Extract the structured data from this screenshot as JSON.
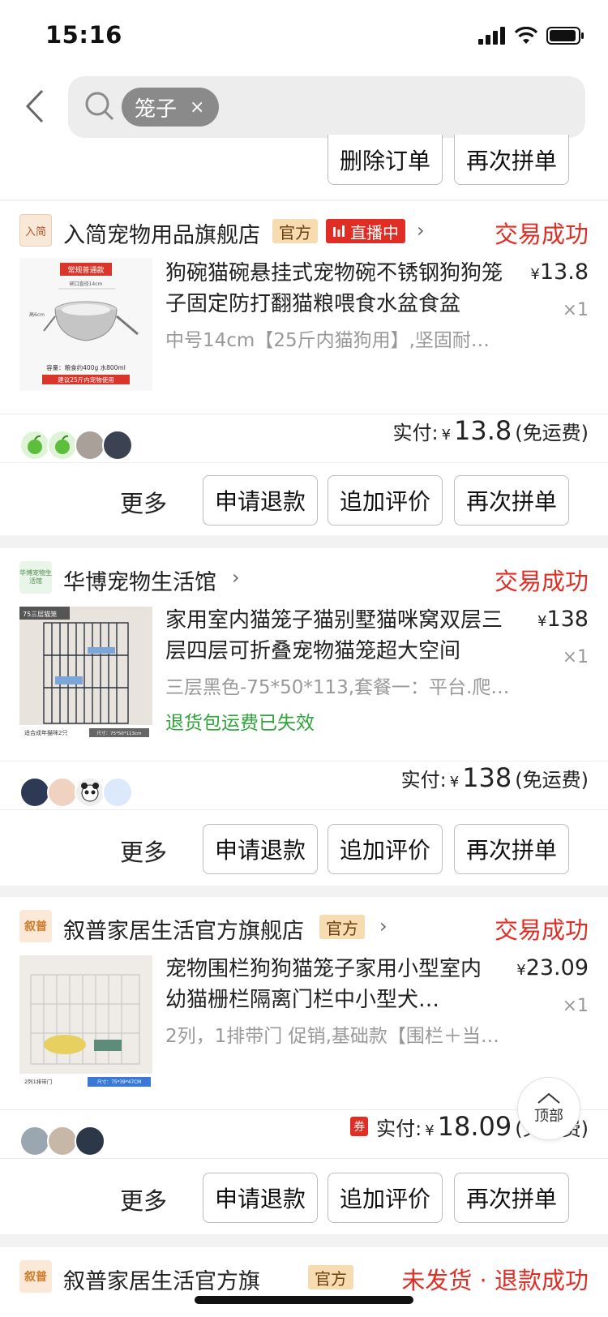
{
  "status_bar": {
    "time": "15:16"
  },
  "search": {
    "keyword": "笼子",
    "clear": "×"
  },
  "top_partial_card": {
    "buttons": [
      "删除订单",
      "再次拼单"
    ]
  },
  "orders": [
    {
      "shop": "入简宠物用品旗舰店",
      "logo_text": "入简",
      "official_badge": "官方",
      "live_badge": "直播中",
      "status": "交易成功",
      "title": "狗碗猫碗悬挂式宠物碗不锈钢狗狗笼子固定防打翻猫粮喂食水盆食盆",
      "spec": "中号14cm【25斤内猫狗用】,坚固耐…",
      "price_currency": "¥",
      "price": "13.8",
      "qty": "×1",
      "paid_label": "实付:",
      "paid_currency": "¥",
      "paid_amount": "13.8",
      "shipping": "(免运费)",
      "more": "更多",
      "actions": [
        "申请退款",
        "追加评价",
        "再次拼单"
      ],
      "thumb_texts": [
        "常规普通款",
        "碗口直径14cm",
        "高6cm",
        "容量：粮食约400g  水800ml",
        "建议25斤内宠物使用"
      ]
    },
    {
      "shop": "华博宠物生活馆",
      "logo_text": "华博宠物生活馆",
      "status": "交易成功",
      "title": "家用室内猫笼子猫别墅猫咪窝双层三层四层可折叠宠物猫笼超大空间",
      "spec": "三层黑色-75*50*113,套餐一：平台.爬…",
      "refund_note": "退货包运费已失效",
      "price_currency": "¥",
      "price": "138",
      "qty": "×1",
      "paid_label": "实付:",
      "paid_currency": "¥",
      "paid_amount": "138",
      "shipping": "(免运费)",
      "more": "更多",
      "actions": [
        "申请退款",
        "追加评价",
        "再次拼单"
      ],
      "thumb_texts": [
        "75三层猫笼",
        "适合成年猫咪2只",
        "尺寸：75*50*113cm"
      ]
    },
    {
      "shop": "叙普家居生活官方旗舰店",
      "logo_text": "叙普",
      "official_badge": "官方",
      "status": "交易成功",
      "title": "宠物围栏狗狗猫笼子家用小型室内幼猫栅栏隔离门栏中小型犬…",
      "spec": "2列，1排带门 促销,基础款【围栏＋当…",
      "price_currency": "¥",
      "price": "23.09",
      "qty": "×1",
      "coupon": "券",
      "paid_label": "实付:",
      "paid_currency": "¥",
      "paid_amount": "18.09",
      "shipping": "(免运费)",
      "more": "更多",
      "actions": [
        "申请退款",
        "追加评价",
        "再次拼单"
      ],
      "thumb_texts": [
        "2列1排带门",
        "尺寸：75*39*47CM"
      ]
    }
  ],
  "bottom_partial": {
    "shop": "叙普家居生活官方旗",
    "badge": "官方",
    "status_a": "未发货",
    "status_b": "退款成功"
  },
  "back_to_top": "顶部",
  "colors": {
    "accent_red": "#e02e24",
    "green": "#30a53a",
    "official_bg": "#f6dcb0"
  }
}
